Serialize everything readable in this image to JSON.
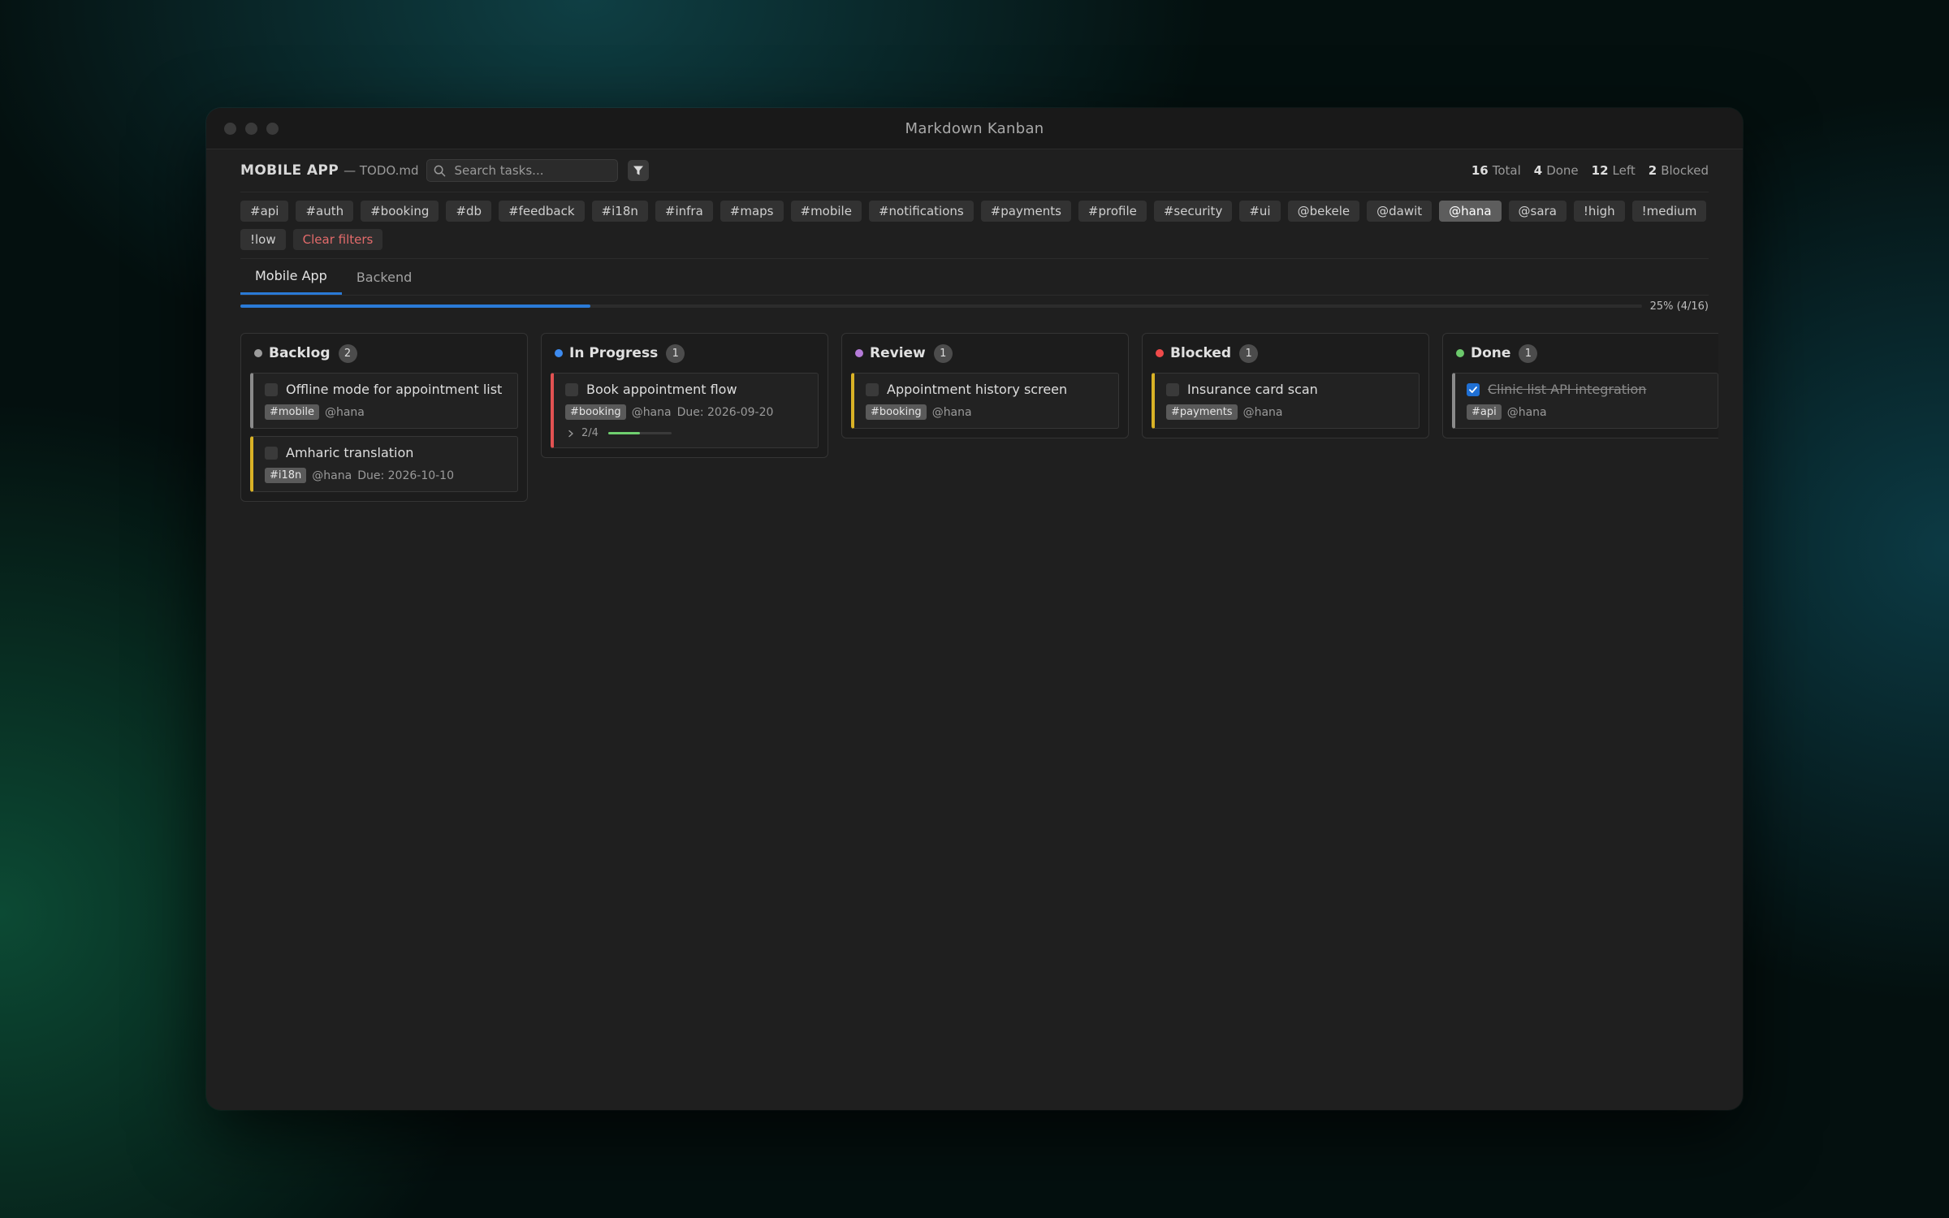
{
  "window": {
    "title": "Markdown Kanban"
  },
  "header": {
    "project": "MOBILE APP",
    "file": "— TODO.md",
    "search_placeholder": "Search tasks...",
    "stats": [
      {
        "value": "16",
        "label": "Total"
      },
      {
        "value": "4",
        "label": "Done"
      },
      {
        "value": "12",
        "label": "Left"
      },
      {
        "value": "2",
        "label": "Blocked"
      }
    ]
  },
  "filters": {
    "chips": [
      "#api",
      "#auth",
      "#booking",
      "#db",
      "#feedback",
      "#i18n",
      "#infra",
      "#maps",
      "#mobile",
      "#notifications",
      "#payments",
      "#profile",
      "#security",
      "#ui",
      "@bekele",
      "@dawit",
      "@hana",
      "@sara",
      "!high",
      "!medium",
      "!low"
    ],
    "active": "@hana",
    "clear_label": "Clear filters"
  },
  "tabs": [
    "Mobile App",
    "Backend"
  ],
  "progress": {
    "label": "25% (4/16)",
    "fraction": 0.25
  },
  "colors": {
    "accent": "#2a7ad6",
    "backlog": "#9b9b9b",
    "in_progress": "#3d8bf0",
    "review": "#b57bd8",
    "blocked": "#ef4a4a",
    "done": "#6cc96c",
    "priority_medium": "#d9b226",
    "priority_high": "#e25252",
    "priority_low": "#8a8a8a"
  },
  "columns": [
    {
      "title": "Backlog",
      "count": "2",
      "cards": [
        {
          "title": "Offline mode for appointment list",
          "tag": "#mobile",
          "user": "@hana"
        },
        {
          "title": "Amharic translation",
          "tag": "#i18n",
          "user": "@hana",
          "due": "Due: 2026-10-10"
        }
      ]
    },
    {
      "title": "In Progress",
      "count": "1",
      "cards": [
        {
          "title": "Book appointment flow",
          "tag": "#booking",
          "user": "@hana",
          "due": "Due: 2026-09-20",
          "subtasks": "2/4",
          "subtask_fraction": 0.5
        }
      ]
    },
    {
      "title": "Review",
      "count": "1",
      "cards": [
        {
          "title": "Appointment history screen",
          "tag": "#booking",
          "user": "@hana"
        }
      ]
    },
    {
      "title": "Blocked",
      "count": "1",
      "cards": [
        {
          "title": "Insurance card scan",
          "tag": "#payments",
          "user": "@hana"
        }
      ]
    },
    {
      "title": "Done",
      "count": "1",
      "cards": [
        {
          "title": "Clinic list API integration",
          "tag": "#api",
          "user": "@hana"
        }
      ]
    }
  ]
}
